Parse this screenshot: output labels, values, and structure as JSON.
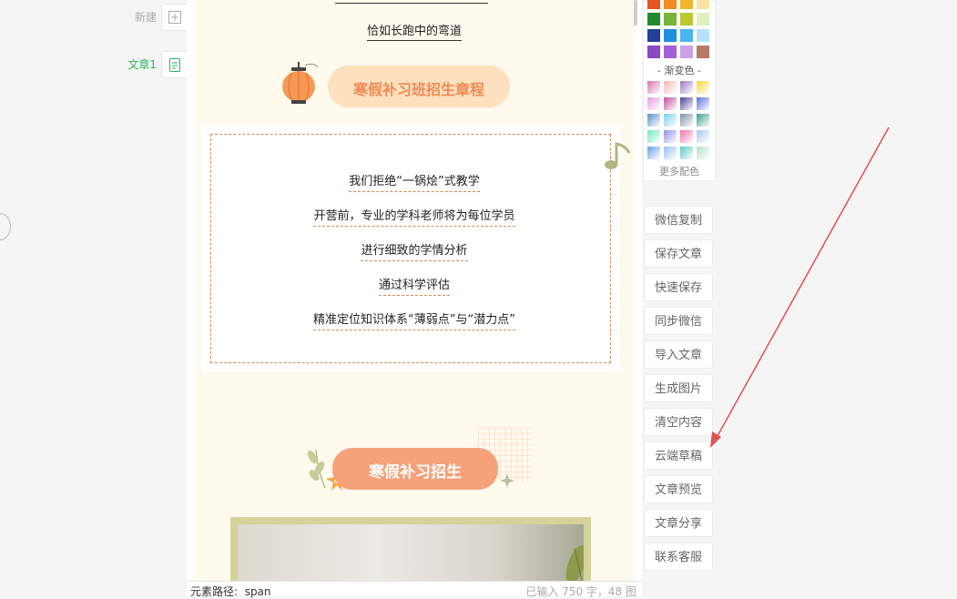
{
  "sidebar": {
    "new_label": "新建",
    "article_label": "文章1"
  },
  "article": {
    "subtitle": "恰如长跑中的弯道",
    "section1_title": "寒假补习班招生章程",
    "lines": [
      "我们拒绝“一锅烩”式教学",
      "开营前，专业的学科老师将为每位学员",
      "进行细致的学情分析",
      "通过科学评估",
      "精准定位知识体系“薄弱点”与“潜力点”"
    ],
    "section2_title": "寒假补习招生"
  },
  "status": {
    "path_label": "元素路径:",
    "path_value": "span",
    "count": "已输入 750 字，48 图"
  },
  "palette": {
    "solid_colors": [
      "#e8541f",
      "#f28c22",
      "#f5b329",
      "#fbe3a0",
      "#1f8a2e",
      "#7ab33a",
      "#b9c930",
      "#dff0c0",
      "#233f9a",
      "#1e90e0",
      "#48b6f0",
      "#b6e3fb",
      "#8b47c4",
      "#a25ed6",
      "#c9a3e6",
      "#b87a68"
    ],
    "gradient_title": "- 渐变色 -",
    "gradient_colors": [
      "#d86fa6",
      "#f7b8b0",
      "#9a78c0",
      "#f5d63a",
      "#e8a0e0",
      "#c24da0",
      "#4a3f9a",
      "#5870d8",
      "#5a8fc8",
      "#7ad0f5",
      "#7a90a0",
      "#3aa090",
      "#6ee8b8",
      "#9090f0",
      "#f070b0",
      "#a8c8f0",
      "#6aa0e8",
      "#98c0f8",
      "#60c8c0",
      "#b8e0c8"
    ],
    "more_label": "更多配色"
  },
  "tools": [
    "微信复制",
    "保存文章",
    "快速保存",
    "同步微信",
    "导入文章",
    "生成图片",
    "清空内容",
    "云端草稿",
    "文章预览",
    "文章分享",
    "联系客服"
  ],
  "colors": {
    "accent_orange": "#f0a078",
    "title_green": "#2bb45c",
    "arrow_red": "#e05050"
  }
}
